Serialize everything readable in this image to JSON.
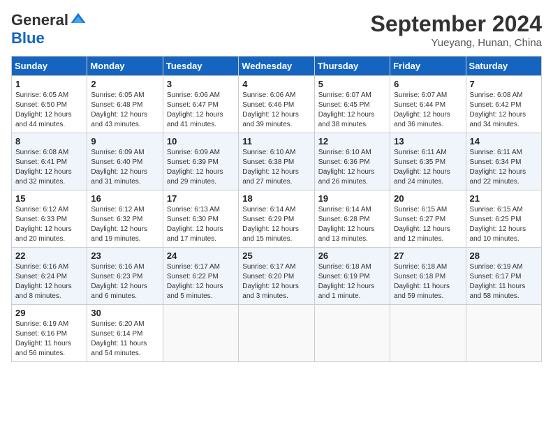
{
  "logo": {
    "general": "General",
    "blue": "Blue"
  },
  "title": {
    "month_year": "September 2024",
    "location": "Yueyang, Hunan, China"
  },
  "days_of_week": [
    "Sunday",
    "Monday",
    "Tuesday",
    "Wednesday",
    "Thursday",
    "Friday",
    "Saturday"
  ],
  "weeks": [
    [
      {
        "day": "1",
        "sunrise": "6:05 AM",
        "sunset": "6:50 PM",
        "daylight": "12 hours and 44 minutes."
      },
      {
        "day": "2",
        "sunrise": "6:05 AM",
        "sunset": "6:48 PM",
        "daylight": "12 hours and 43 minutes."
      },
      {
        "day": "3",
        "sunrise": "6:06 AM",
        "sunset": "6:47 PM",
        "daylight": "12 hours and 41 minutes."
      },
      {
        "day": "4",
        "sunrise": "6:06 AM",
        "sunset": "6:46 PM",
        "daylight": "12 hours and 39 minutes."
      },
      {
        "day": "5",
        "sunrise": "6:07 AM",
        "sunset": "6:45 PM",
        "daylight": "12 hours and 38 minutes."
      },
      {
        "day": "6",
        "sunrise": "6:07 AM",
        "sunset": "6:44 PM",
        "daylight": "12 hours and 36 minutes."
      },
      {
        "day": "7",
        "sunrise": "6:08 AM",
        "sunset": "6:42 PM",
        "daylight": "12 hours and 34 minutes."
      }
    ],
    [
      {
        "day": "8",
        "sunrise": "6:08 AM",
        "sunset": "6:41 PM",
        "daylight": "12 hours and 32 minutes."
      },
      {
        "day": "9",
        "sunrise": "6:09 AM",
        "sunset": "6:40 PM",
        "daylight": "12 hours and 31 minutes."
      },
      {
        "day": "10",
        "sunrise": "6:09 AM",
        "sunset": "6:39 PM",
        "daylight": "12 hours and 29 minutes."
      },
      {
        "day": "11",
        "sunrise": "6:10 AM",
        "sunset": "6:38 PM",
        "daylight": "12 hours and 27 minutes."
      },
      {
        "day": "12",
        "sunrise": "6:10 AM",
        "sunset": "6:36 PM",
        "daylight": "12 hours and 26 minutes."
      },
      {
        "day": "13",
        "sunrise": "6:11 AM",
        "sunset": "6:35 PM",
        "daylight": "12 hours and 24 minutes."
      },
      {
        "day": "14",
        "sunrise": "6:11 AM",
        "sunset": "6:34 PM",
        "daylight": "12 hours and 22 minutes."
      }
    ],
    [
      {
        "day": "15",
        "sunrise": "6:12 AM",
        "sunset": "6:33 PM",
        "daylight": "12 hours and 20 minutes."
      },
      {
        "day": "16",
        "sunrise": "6:12 AM",
        "sunset": "6:32 PM",
        "daylight": "12 hours and 19 minutes."
      },
      {
        "day": "17",
        "sunrise": "6:13 AM",
        "sunset": "6:30 PM",
        "daylight": "12 hours and 17 minutes."
      },
      {
        "day": "18",
        "sunrise": "6:14 AM",
        "sunset": "6:29 PM",
        "daylight": "12 hours and 15 minutes."
      },
      {
        "day": "19",
        "sunrise": "6:14 AM",
        "sunset": "6:28 PM",
        "daylight": "12 hours and 13 minutes."
      },
      {
        "day": "20",
        "sunrise": "6:15 AM",
        "sunset": "6:27 PM",
        "daylight": "12 hours and 12 minutes."
      },
      {
        "day": "21",
        "sunrise": "6:15 AM",
        "sunset": "6:25 PM",
        "daylight": "12 hours and 10 minutes."
      }
    ],
    [
      {
        "day": "22",
        "sunrise": "6:16 AM",
        "sunset": "6:24 PM",
        "daylight": "12 hours and 8 minutes."
      },
      {
        "day": "23",
        "sunrise": "6:16 AM",
        "sunset": "6:23 PM",
        "daylight": "12 hours and 6 minutes."
      },
      {
        "day": "24",
        "sunrise": "6:17 AM",
        "sunset": "6:22 PM",
        "daylight": "12 hours and 5 minutes."
      },
      {
        "day": "25",
        "sunrise": "6:17 AM",
        "sunset": "6:20 PM",
        "daylight": "12 hours and 3 minutes."
      },
      {
        "day": "26",
        "sunrise": "6:18 AM",
        "sunset": "6:19 PM",
        "daylight": "12 hours and 1 minute."
      },
      {
        "day": "27",
        "sunrise": "6:18 AM",
        "sunset": "6:18 PM",
        "daylight": "11 hours and 59 minutes."
      },
      {
        "day": "28",
        "sunrise": "6:19 AM",
        "sunset": "6:17 PM",
        "daylight": "11 hours and 58 minutes."
      }
    ],
    [
      {
        "day": "29",
        "sunrise": "6:19 AM",
        "sunset": "6:16 PM",
        "daylight": "11 hours and 56 minutes."
      },
      {
        "day": "30",
        "sunrise": "6:20 AM",
        "sunset": "6:14 PM",
        "daylight": "11 hours and 54 minutes."
      },
      null,
      null,
      null,
      null,
      null
    ]
  ]
}
